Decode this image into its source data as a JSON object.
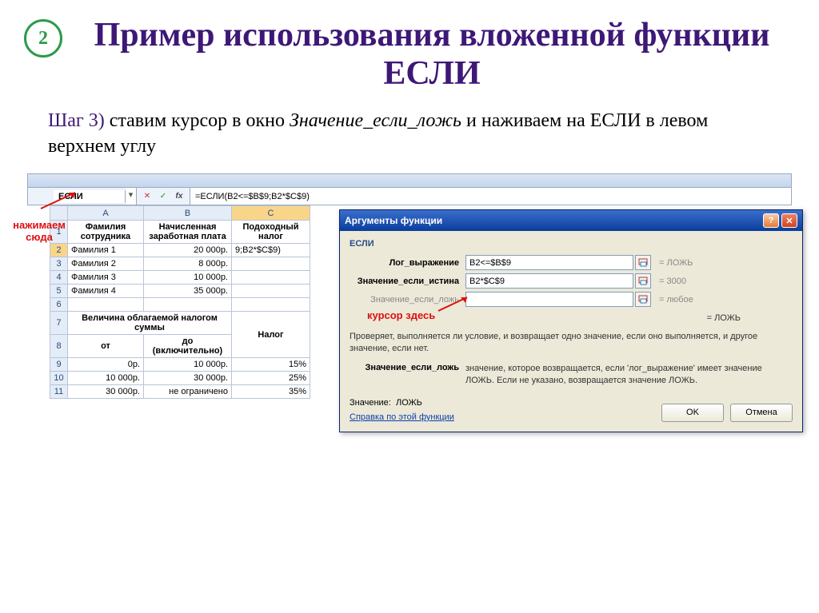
{
  "slide": {
    "number": "2",
    "title": "Пример использования вложенной функции ЕСЛИ",
    "step_label": "Шаг 3)",
    "step_text_1": " ставим курсор в окно ",
    "step_italic": "Значение_если_ложь",
    "step_text_2": " и наживаем на ЕСЛИ в левом верхнем углу"
  },
  "callouts": {
    "click_here": "нажимаем сюда",
    "cursor_here": "курсор здесь"
  },
  "formula_bar": {
    "name_box": "ЕСЛИ",
    "fx": "fx",
    "formula": "=ЕСЛИ(B2<=$B$9;B2*$C$9)"
  },
  "columns": {
    "a": "A",
    "b": "B",
    "c": "C"
  },
  "headers": {
    "lastname": "Фамилия сотрудника",
    "salary": "Начисленная заработная плата",
    "tax": "Подоходный налог",
    "taxable_amount": "Величина облагаемой налогом суммы",
    "from": "от",
    "to": "до (включительно)",
    "tax2": "Налог"
  },
  "rows": {
    "r2": {
      "a": "Фамилия 1",
      "b": "20 000р.",
      "c": "9;B2*$C$9)"
    },
    "r3": {
      "a": "Фамилия 2",
      "b": "8 000р.",
      "c": ""
    },
    "r4": {
      "a": "Фамилия 3",
      "b": "10 000р.",
      "c": ""
    },
    "r5": {
      "a": "Фамилия 4",
      "b": "35 000р.",
      "c": ""
    },
    "r9": {
      "a": "0р.",
      "b": "10 000р.",
      "c": "15%"
    },
    "r10": {
      "a": "10 000р.",
      "b": "30 000р.",
      "c": "25%"
    },
    "r11": {
      "a": "30 000р.",
      "b": "не ограничено",
      "c": "35%"
    }
  },
  "rownums": {
    "1": "1",
    "2": "2",
    "3": "3",
    "4": "4",
    "5": "5",
    "6": "6",
    "7": "7",
    "8": "8",
    "9": "9",
    "10": "10",
    "11": "11"
  },
  "dialog": {
    "title": "Аргументы функции",
    "fn": "ЕСЛИ",
    "arg1_label": "Лог_выражение",
    "arg1_value": "B2<=$B$9",
    "arg1_result": "=  ЛОЖЬ",
    "arg2_label": "Значение_если_истина",
    "arg2_value": "B2*$C$9",
    "arg2_result": "=  3000",
    "arg3_label": "Значение_если_ложь",
    "arg3_value": "",
    "arg3_result": "=  любое",
    "overall_result": "=  ЛОЖЬ",
    "desc": "Проверяет, выполняется ли условие, и возвращает одно значение, если оно выполняется, и другое значение, если нет.",
    "arg_desc_label": "Значение_если_ложь",
    "arg_desc_text": "значение, которое возвращается, если 'лог_выражение' имеет значение ЛОЖЬ. Если не указано, возвращается значение ЛОЖЬ.",
    "value_label": "Значение:",
    "value": "ЛОЖЬ",
    "help_link": "Справка по этой функции",
    "ok": "OK",
    "cancel": "Отмена"
  }
}
